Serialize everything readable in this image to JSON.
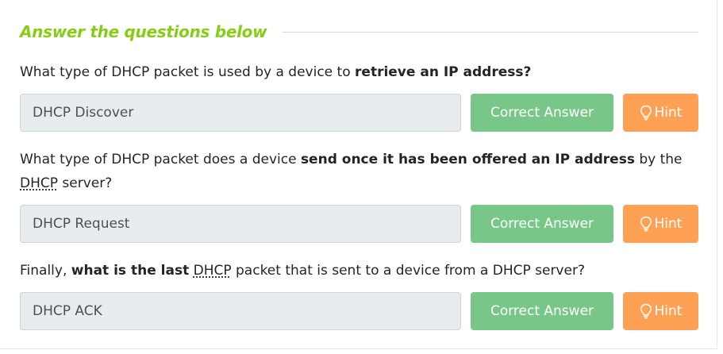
{
  "section": {
    "title": "Answer the questions below"
  },
  "questions": [
    {
      "parts": [
        "What type of DHCP packet is used by a device to ",
        "retrieve an IP address?"
      ],
      "answer": "DHCP Discover",
      "correct_label": "Correct Answer",
      "hint_label": "Hint"
    },
    {
      "parts": [
        "What type of DHCP packet does a device ",
        "send once it has been offered an IP address",
        " by the ",
        "DHCP",
        " server?"
      ],
      "answer": "DHCP Request",
      "correct_label": "Correct Answer",
      "hint_label": "Hint"
    },
    {
      "parts": [
        "Finally, ",
        "what is the last",
        " ",
        "DHCP",
        " packet that is sent to a device from a DHCP server?"
      ],
      "answer": "DHCP ACK",
      "correct_label": "Correct Answer",
      "hint_label": "Hint"
    }
  ],
  "colors": {
    "section_title": "#88cc14",
    "correct_button": "#78c788",
    "hint_button": "#ffa154",
    "input_background": "#e9ecef"
  },
  "icons": {
    "hint": "lightbulb-icon"
  }
}
